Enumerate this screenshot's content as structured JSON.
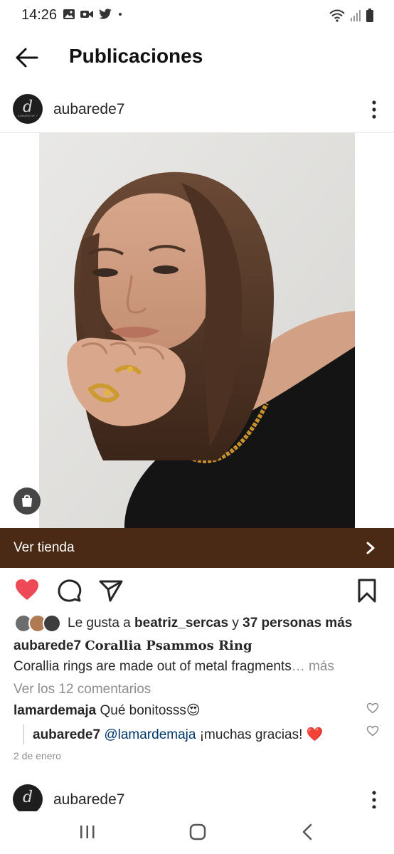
{
  "status_bar": {
    "time": "14:26",
    "left_icons": [
      "gallery-icon",
      "video-call-icon",
      "twitter-icon",
      "dot-icon"
    ],
    "right_icons": [
      "wifi-icon",
      "signal-icon",
      "battery-icon"
    ]
  },
  "header": {
    "title": "Publicaciones",
    "back_icon": "arrow-left-icon"
  },
  "post": {
    "avatar_letter": "d",
    "avatar_sub": "AUBAREDE 7",
    "username": "aubarede7",
    "shop_label": "Ver tienda",
    "likes": {
      "prefix": "Le gusta a ",
      "user": "beatriz_sercas",
      "middle": " y ",
      "others": "37 personas más"
    },
    "caption_user": "aubarede7",
    "caption_title": "Corallia Psammos Ring",
    "caption_body": "Corallia rings are made out of metal fragments",
    "caption_more": "… más",
    "view_comments": "Ver los 12 comentarios",
    "comments": [
      {
        "user": "lamardemaja",
        "text": "Qué bonitosss😍"
      },
      {
        "user": "aubarede7",
        "mention": "@lamardemaja",
        "text": " ¡muchas gracias! ❤️"
      }
    ],
    "date": "2 de enero",
    "liked": true
  },
  "next_post": {
    "avatar_letter": "d",
    "username": "aubarede7"
  },
  "colors": {
    "shop_bar": "#4a2a14",
    "like_red": "#ed4956",
    "mention": "#00376b",
    "muted": "#8e8e8e"
  }
}
